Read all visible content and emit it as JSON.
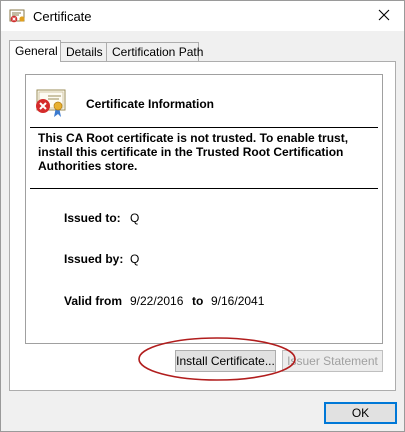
{
  "window": {
    "title": "Certificate"
  },
  "tabs": [
    {
      "label": "General"
    },
    {
      "label": "Details"
    },
    {
      "label": "Certification Path"
    }
  ],
  "info": {
    "heading": "Certificate Information",
    "warning": "This CA Root certificate is not trusted. To enable trust, install this certificate in the Trusted Root Certification Authorities store."
  },
  "fields": {
    "issued_to_label": "Issued to:",
    "issued_to_value": "Q",
    "issued_by_label": "Issued by:",
    "issued_by_value": "Q",
    "valid_from_label": "Valid from",
    "valid_from_value": "9/22/2016",
    "valid_to_label": "to",
    "valid_to_value": "9/16/2041"
  },
  "buttons": {
    "install": "Install Certificate...",
    "issuer_statement": "Issuer Statement",
    "ok": "OK"
  },
  "colors": {
    "highlight": "#b11d1d",
    "focus": "#0078d7"
  },
  "icons": [
    "certificate-icon",
    "close-icon",
    "certificate-error-icon"
  ]
}
